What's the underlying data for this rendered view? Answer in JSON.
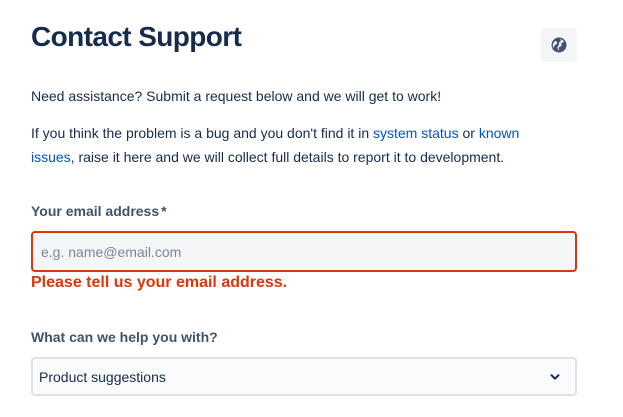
{
  "header": {
    "title": "Contact Support",
    "language_icon": "globe-icon"
  },
  "intro": {
    "line1": "Need assistance? Submit a request below and we will get to work!",
    "line2_part1": "If you think the problem is a bug and you don't find it in ",
    "system_status_link": "system status",
    "line2_part2": " or ",
    "known_issues_link": "known issues",
    "line2_part3": ", raise it here and we will collect full details to report it to development."
  },
  "email_field": {
    "label": "Your email address",
    "required_marker": "*",
    "value": "",
    "placeholder": "e.g. name@email.com",
    "error": "Please tell us your email address."
  },
  "help_field": {
    "label": "What can we help you with?",
    "selected": "Product suggestions",
    "icon": "chevron-down-icon"
  },
  "colors": {
    "error": "#de350b",
    "link": "#0052cc",
    "text": "#172b4d",
    "label": "#42526e"
  }
}
